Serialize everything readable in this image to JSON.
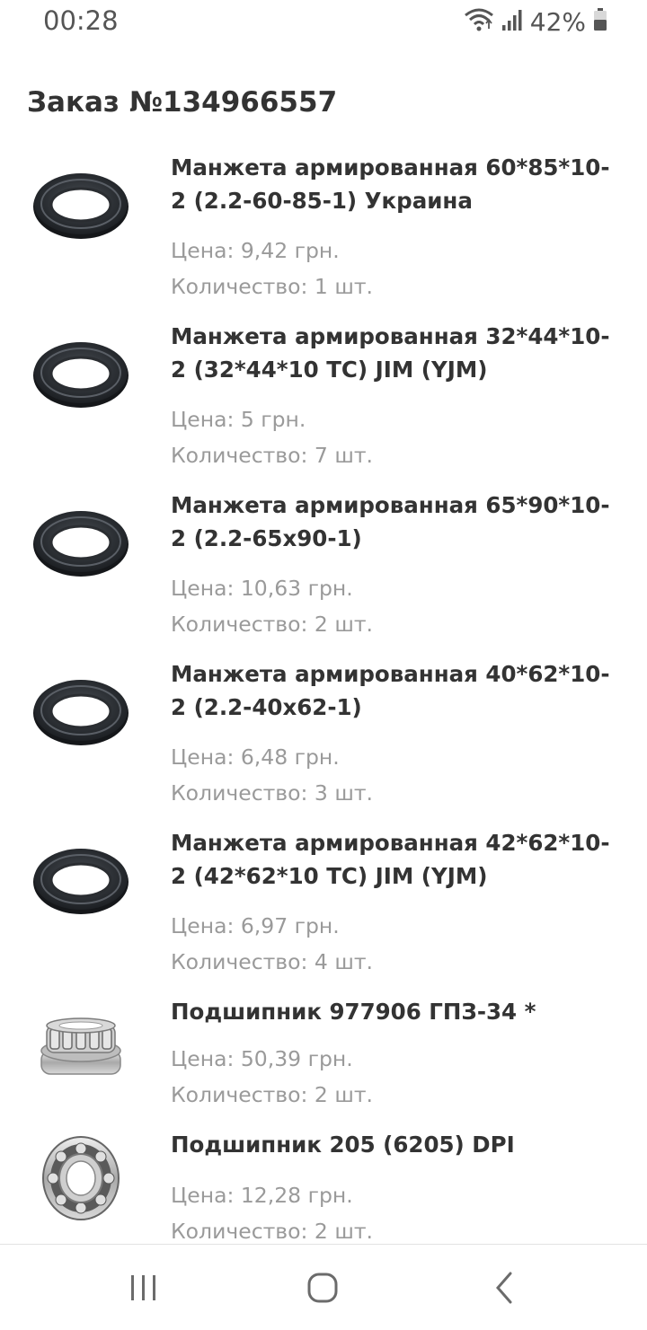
{
  "status_bar": {
    "time": "00:28",
    "battery_percent": "42%",
    "icons": [
      "wifi-icon",
      "signal-icon",
      "battery-icon"
    ]
  },
  "order": {
    "title": "Заказ №134966557",
    "items": [
      {
        "name": "Манжета армированная 60*85*10-2 (2.2-60-85-1) Украина",
        "price": "Цена: 9,42 грн.",
        "quantity": "Количество: 1 шт.",
        "image": "oil-seal-icon"
      },
      {
        "name": "Манжета армированная 32*44*10-2 (32*44*10 TC) JIM (YJM)",
        "price": "Цена: 5 грн.",
        "quantity": "Количество: 7 шт.",
        "image": "oil-seal-icon"
      },
      {
        "name": "Манжета армированная 65*90*10-2 (2.2-65x90-1)",
        "price": "Цена: 10,63 грн.",
        "quantity": "Количество: 2 шт.",
        "image": "oil-seal-icon"
      },
      {
        "name": "Манжета армированная 40*62*10-2 (2.2-40x62-1)",
        "price": "Цена: 6,48 грн.",
        "quantity": "Количество: 3 шт.",
        "image": "oil-seal-icon"
      },
      {
        "name": "Манжета армированная 42*62*10-2 (42*62*10 TC) JIM (YJM)",
        "price": "Цена: 6,97 грн.",
        "quantity": "Количество: 4 шт.",
        "image": "oil-seal-icon"
      },
      {
        "name": "Подшипник 977906 ГПЗ-34 *",
        "price": "Цена: 50,39 грн.",
        "quantity": "Количество: 2 шт.",
        "image": "roller-bearing-icon"
      },
      {
        "name": "Подшипник 205 (6205) DPI",
        "price": "Цена: 12,28 грн.",
        "quantity": "Количество: 2 шт.",
        "image": "ball-bearing-icon"
      }
    ]
  },
  "nav_bar": {
    "buttons": [
      "recents-icon",
      "home-icon",
      "back-icon"
    ]
  }
}
